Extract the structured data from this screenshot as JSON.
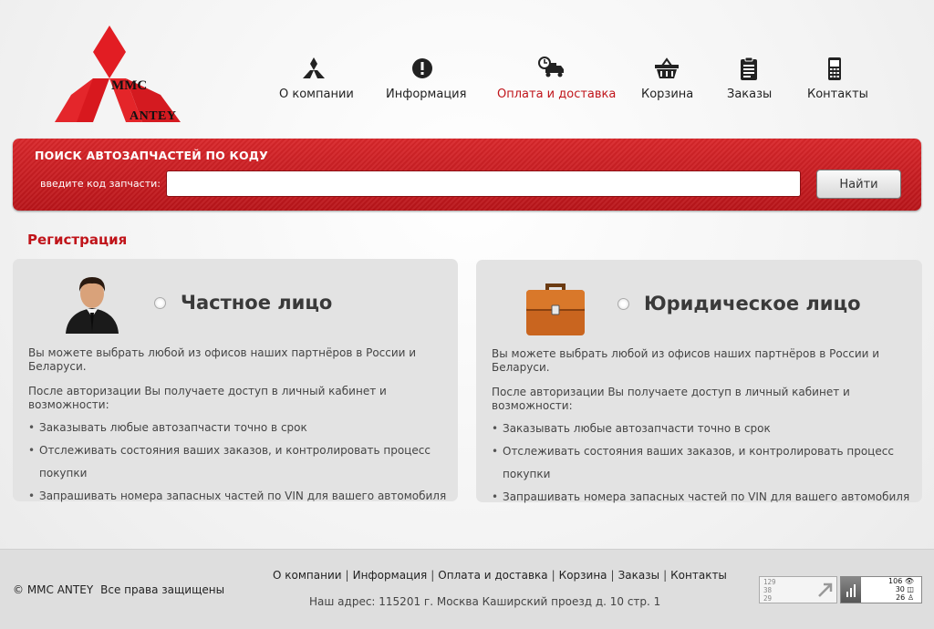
{
  "brand": {
    "line1": "MMC",
    "line2": "ANTEY"
  },
  "nav": [
    {
      "label": "О компании",
      "icon": "mitsubishi-logo-icon"
    },
    {
      "label": "Информация",
      "icon": "exclamation-icon"
    },
    {
      "label": "Оплата и доставка",
      "icon": "delivery-truck-icon",
      "active": true
    },
    {
      "label": "Корзина",
      "icon": "basket-icon"
    },
    {
      "label": "Заказы",
      "icon": "clipboard-icon"
    },
    {
      "label": "Контакты",
      "icon": "phone-icon"
    }
  ],
  "search": {
    "title": "ПОИСК АВТОЗАПЧАСТЕЙ ПО КОДУ",
    "label": "введите код запчасти:",
    "value": "",
    "button": "Найти"
  },
  "registration": {
    "title": "Регистрация",
    "cards": [
      {
        "heading": "Частное лицо",
        "icon": "person-icon",
        "intro": "Вы можете выбрать любой из офисов наших партнёров в России и Беларуси.",
        "lead": "После авторизации Вы получаете доступ в личный кабинет и возможности:",
        "items": [
          "Заказывать любые автозапчасти точно в срок",
          "Отслеживать состояния ваших заказов, и контролировать процесс покупки",
          "Запрашивать номера запасных частей по VIN для вашего автомобиля"
        ]
      },
      {
        "heading": "Юридическое лицо",
        "icon": "briefcase-icon",
        "intro": "Вы можете выбрать любой из офисов наших партнёров в России и Беларуси.",
        "lead": "После авторизации Вы получаете доступ в личный кабинет и возможности:",
        "items": [
          "Заказывать любые автозапчасти точно в срок",
          "Отслеживать состояния ваших заказов, и контролировать процесс покупки",
          "Запрашивать номера запасных частей по VIN для вашего автомобиля"
        ]
      }
    ]
  },
  "footer": {
    "copyright": "© MMC ANTEY",
    "rights": "Все права защищены",
    "links": [
      "О компании",
      "Информация",
      "Оплата и доставка",
      "Корзина",
      "Заказы",
      "Контакты"
    ],
    "address": "Наш адрес: 115201 г. Москва Каширский проезд д. 10 стр. 1",
    "counter1": [
      "129",
      "38",
      "29"
    ],
    "counter2": [
      "106",
      "30",
      "26"
    ]
  },
  "colors": {
    "accent": "#c0141a",
    "search_bg": "#c8191e"
  }
}
